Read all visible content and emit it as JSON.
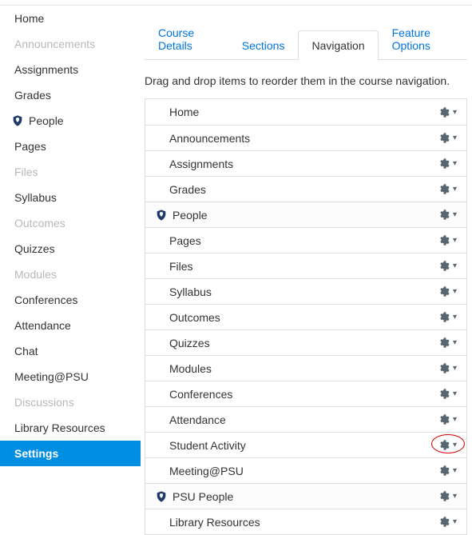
{
  "tabs": [
    {
      "label": "Course Details"
    },
    {
      "label": "Sections"
    },
    {
      "label": "Navigation"
    },
    {
      "label": "Feature Options"
    }
  ],
  "active_tab_index": 2,
  "instructions": "Drag and drop items to reorder them in the course navigation.",
  "sidebar": [
    {
      "label": "Home",
      "muted": false,
      "icon": null
    },
    {
      "label": "Announcements",
      "muted": true,
      "icon": null
    },
    {
      "label": "Assignments",
      "muted": false,
      "icon": null
    },
    {
      "label": "Grades",
      "muted": false,
      "icon": null
    },
    {
      "label": "People",
      "muted": false,
      "icon": "shield"
    },
    {
      "label": "Pages",
      "muted": false,
      "icon": null
    },
    {
      "label": "Files",
      "muted": true,
      "icon": null
    },
    {
      "label": "Syllabus",
      "muted": false,
      "icon": null
    },
    {
      "label": "Outcomes",
      "muted": true,
      "icon": null
    },
    {
      "label": "Quizzes",
      "muted": false,
      "icon": null
    },
    {
      "label": "Modules",
      "muted": true,
      "icon": null
    },
    {
      "label": "Conferences",
      "muted": false,
      "icon": null
    },
    {
      "label": "Attendance",
      "muted": false,
      "icon": null
    },
    {
      "label": "Chat",
      "muted": false,
      "icon": null
    },
    {
      "label": "Meeting@PSU",
      "muted": false,
      "icon": null
    },
    {
      "label": "Discussions",
      "muted": true,
      "icon": null
    },
    {
      "label": "Library Resources",
      "muted": false,
      "icon": null
    },
    {
      "label": "Settings",
      "muted": false,
      "icon": null,
      "active": true
    }
  ],
  "nav_items": [
    {
      "label": "Home",
      "indent": true,
      "icon": null
    },
    {
      "label": "Announcements",
      "indent": true,
      "icon": null
    },
    {
      "label": "Assignments",
      "indent": true,
      "icon": null
    },
    {
      "label": "Grades",
      "indent": true,
      "icon": null
    },
    {
      "label": "People",
      "indent": false,
      "icon": "shield",
      "header": true
    },
    {
      "label": "Pages",
      "indent": true,
      "icon": null
    },
    {
      "label": "Files",
      "indent": true,
      "icon": null
    },
    {
      "label": "Syllabus",
      "indent": true,
      "icon": null
    },
    {
      "label": "Outcomes",
      "indent": true,
      "icon": null
    },
    {
      "label": "Quizzes",
      "indent": true,
      "icon": null
    },
    {
      "label": "Modules",
      "indent": true,
      "icon": null
    },
    {
      "label": "Conferences",
      "indent": true,
      "icon": null
    },
    {
      "label": "Attendance",
      "indent": true,
      "icon": null
    },
    {
      "label": "Student Activity",
      "indent": true,
      "icon": null,
      "highlight": true
    },
    {
      "label": "Meeting@PSU",
      "indent": true,
      "icon": null
    },
    {
      "label": "PSU People",
      "indent": false,
      "icon": "shield",
      "header": true
    },
    {
      "label": "Library Resources",
      "indent": true,
      "icon": null
    }
  ]
}
